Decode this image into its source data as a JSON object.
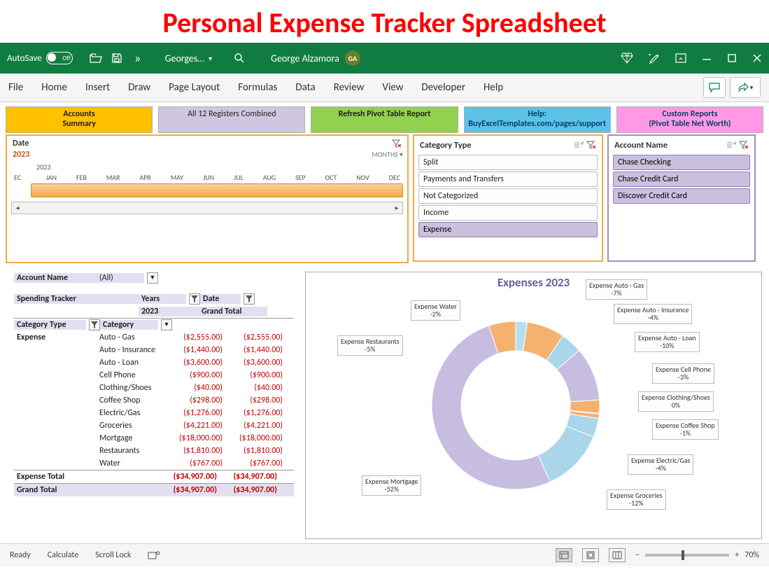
{
  "page_title": "Personal Expense Tracker Spreadsheet",
  "titlebar": {
    "autosave_label": "AutoSave",
    "autosave_state": "Off",
    "doc_name": "Georges…",
    "user_name": "George Alzamora",
    "user_initials": "GA"
  },
  "ribbon": {
    "tabs": [
      "File",
      "Home",
      "Insert",
      "Draw",
      "Page Layout",
      "Formulas",
      "Data",
      "Review",
      "View",
      "Developer",
      "Help"
    ]
  },
  "navtabs": [
    {
      "label": "Accounts\nSummary",
      "cls": "nt-yellow"
    },
    {
      "label": "All 12 Registers Combined",
      "cls": "nt-lav"
    },
    {
      "label": "Refresh Pivot Table Report",
      "cls": "nt-green"
    },
    {
      "label": "Help:\nBuyExcelTemplates.com/pages/support",
      "cls": "nt-cyan"
    },
    {
      "label": "Custom Reports\n(Pivot Table Net Worth)",
      "cls": "nt-pink"
    }
  ],
  "timeline": {
    "title": "Date",
    "selected_year": "2023",
    "header_year": "2023",
    "granularity_label": "MONTHS",
    "months_prefix": "EC",
    "months": [
      "JAN",
      "FEB",
      "MAR",
      "APR",
      "MAY",
      "JUN",
      "JUL",
      "AUG",
      "SEP",
      "OCT",
      "NOV",
      "DEC"
    ]
  },
  "slicer_category": {
    "title": "Category Type",
    "items": [
      {
        "label": "Split",
        "selected": false
      },
      {
        "label": "Payments and Transfers",
        "selected": false
      },
      {
        "label": "Not Categorized",
        "selected": false
      },
      {
        "label": "Income",
        "selected": false
      },
      {
        "label": "Expense",
        "selected": true
      }
    ]
  },
  "slicer_account": {
    "title": "Account Name",
    "items": [
      {
        "label": "Chase Checking",
        "selected": true
      },
      {
        "label": "Chase Credit Card",
        "selected": true
      },
      {
        "label": "Discover Credit Card",
        "selected": true
      }
    ]
  },
  "pivot": {
    "filter_label": "Account Name",
    "filter_value": "(All)",
    "header1": "Spending Tracker",
    "header_years": "Years",
    "header_date": "Date",
    "year_shown": "2023",
    "grand_total_label": "Grand Total",
    "cat_header": "Category Type",
    "sub_header": "Category",
    "category_group": "Expense",
    "rows": [
      {
        "sub": "Auto - Gas",
        "val": "($2,555.00)",
        "tot": "($2,555.00)"
      },
      {
        "sub": "Auto - Insurance",
        "val": "($1,440.00)",
        "tot": "($1,440.00)"
      },
      {
        "sub": "Auto - Loan",
        "val": "($3,600.00)",
        "tot": "($3,600.00)"
      },
      {
        "sub": "Cell Phone",
        "val": "($900.00)",
        "tot": "($900.00)"
      },
      {
        "sub": "Clothing/Shoes",
        "val": "($40.00)",
        "tot": "($40.00)"
      },
      {
        "sub": "Coffee Shop",
        "val": "($298.00)",
        "tot": "($298.00)"
      },
      {
        "sub": "Electric/Gas",
        "val": "($1,276.00)",
        "tot": "($1,276.00)"
      },
      {
        "sub": "Groceries",
        "val": "($4,221.00)",
        "tot": "($4,221.00)"
      },
      {
        "sub": "Mortgage",
        "val": "($18,000.00)",
        "tot": "($18,000.00)"
      },
      {
        "sub": "Restaurants",
        "val": "($1,810.00)",
        "tot": "($1,810.00)"
      },
      {
        "sub": "Water",
        "val": "($767.00)",
        "tot": "($767.00)"
      }
    ],
    "expense_total_label": "Expense Total",
    "expense_total_val": "($34,907.00)",
    "expense_total_tot": "($34,907.00)",
    "grand_total_val": "($34,907.00)",
    "grand_total_tot": "($34,907.00)"
  },
  "chart": {
    "title": "Expenses 2023"
  },
  "chart_data": {
    "type": "pie",
    "title": "Expenses 2023",
    "series": [
      {
        "name": "Expense",
        "slices": [
          {
            "label": "Expense Water",
            "pct": -2,
            "value": 767,
            "color": "#b5dff1"
          },
          {
            "label": "Expense Auto - Gas",
            "pct": -7,
            "value": 2555,
            "color": "#f4b26e"
          },
          {
            "label": "Expense Auto - Insurance",
            "pct": -4,
            "value": 1440,
            "color": "#a9d6ea"
          },
          {
            "label": "Expense Auto - Loan",
            "pct": -10,
            "value": 3600,
            "color": "#c7bde0"
          },
          {
            "label": "Expense Cell Phone",
            "pct": -3,
            "value": 900,
            "color": "#f4b26e"
          },
          {
            "label": "Expense Clothing/Shoes",
            "pct": 0,
            "value": 40,
            "color": "#bfbfbf"
          },
          {
            "label": "Expense Coffee Shop",
            "pct": -1,
            "value": 298,
            "color": "#f4b26e"
          },
          {
            "label": "Expense Electric/Gas",
            "pct": -4,
            "value": 1276,
            "color": "#a9d6ea"
          },
          {
            "label": "Expense Groceries",
            "pct": -12,
            "value": 4221,
            "color": "#a9d6ea"
          },
          {
            "label": "Expense Mortgage",
            "pct": -52,
            "value": 18000,
            "color": "#c7bde0"
          },
          {
            "label": "Expense Restaurants",
            "pct": -5,
            "value": 1810,
            "color": "#f4b26e"
          }
        ]
      }
    ]
  },
  "statusbar": {
    "ready": "Ready",
    "calc": "Calculate",
    "scroll": "Scroll Lock",
    "zoom": "70%"
  }
}
